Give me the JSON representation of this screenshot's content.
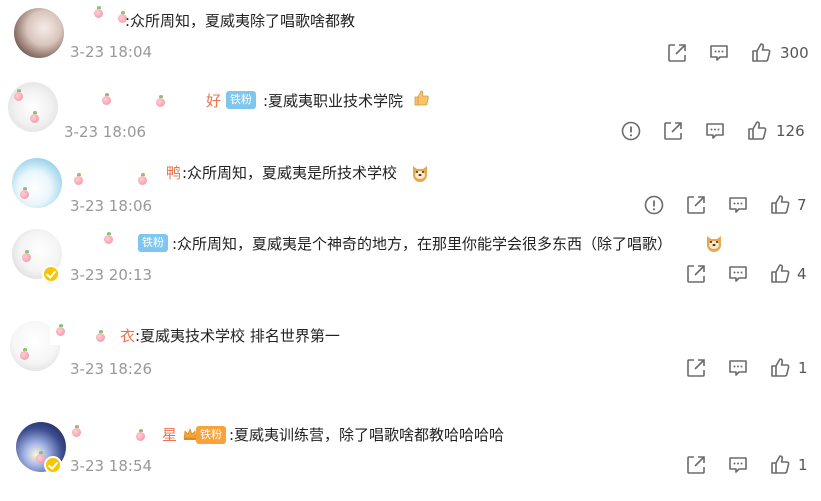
{
  "comments": [
    {
      "name_tail": "",
      "badge": "",
      "text": ":众所周知，夏威夷除了唱歌啥都教",
      "time": "3-23 18:04",
      "like_count": "300"
    },
    {
      "name_tail": "好",
      "badge": "铁粉",
      "text": ":夏威夷职业技术学院",
      "time": "3-23 18:06",
      "like_count": "126"
    },
    {
      "name_tail": "鸭",
      "badge": "",
      "text": ":众所周知，夏威夷是所技术学校",
      "time": "3-23 18:06",
      "like_count": "7"
    },
    {
      "name_tail": "",
      "badge": "铁粉",
      "text": ":众所周知，夏威夷是个神奇的地方，在那里你能学会很多东西（除了唱歌）",
      "time": "3-23 20:13",
      "like_count": "4"
    },
    {
      "name_tail": "衣",
      "badge": "",
      "text": ":夏威夷技术学校 排名世界第一",
      "time": "3-23 18:26",
      "like_count": "1"
    },
    {
      "name_tail": "星",
      "badge": "铁粉",
      "text": ":夏威夷训练营，除了唱歌啥都教哈哈哈哈",
      "time": "3-23 18:54",
      "like_count": "1"
    }
  ],
  "icons": {
    "report": "report-icon",
    "share": "share-icon",
    "reply": "comment-icon",
    "like": "thumbs-up-icon"
  },
  "colors": {
    "name": "#eb7350",
    "badge": "#7fc6ee",
    "time": "#999999",
    "icon": "#6b6b6b"
  }
}
